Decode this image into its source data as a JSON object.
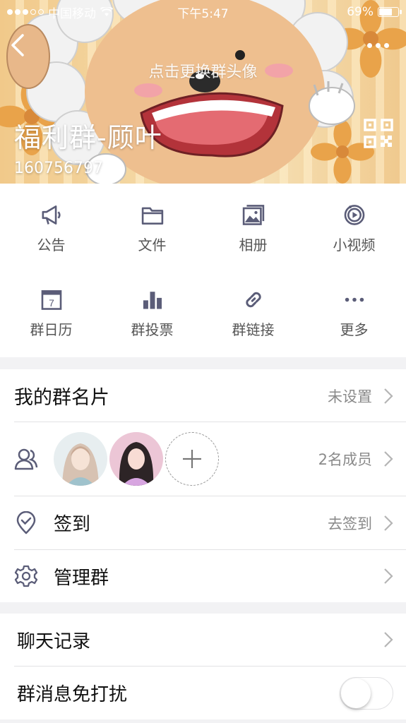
{
  "status_bar": {
    "carrier": "中国移动",
    "time": "下午5:47",
    "battery": "69%",
    "battery_level": 0.69
  },
  "header": {
    "change_avatar_hint": "点击更换群头像",
    "group_name": "福利群-顾叶",
    "group_id": "160756797",
    "back_icon": "chevron-left-icon",
    "more_icon": "ellipsis-icon",
    "qr_icon": "qr-code-icon"
  },
  "features": [
    {
      "label": "公告",
      "icon": "megaphone-icon"
    },
    {
      "label": "文件",
      "icon": "folder-icon"
    },
    {
      "label": "相册",
      "icon": "photo-album-icon"
    },
    {
      "label": "小视频",
      "icon": "video-play-icon"
    },
    {
      "label": "群日历",
      "icon": "calendar-icon",
      "calendar_day": "7"
    },
    {
      "label": "群投票",
      "icon": "bar-chart-icon"
    },
    {
      "label": "群链接",
      "icon": "link-icon"
    },
    {
      "label": "更多",
      "icon": "more-dots-icon"
    }
  ],
  "list": {
    "group_card": {
      "title": "我的群名片",
      "value": "未设置"
    },
    "members": {
      "value": "2名成员"
    },
    "checkin": {
      "title": "签到",
      "value": "去签到"
    },
    "manage": {
      "title": "管理群"
    },
    "chat_history": {
      "title": "聊天记录"
    },
    "mute": {
      "title": "群消息免打扰",
      "enabled": false
    }
  },
  "colors": {
    "icon": "#5b5d78",
    "text_secondary": "#8a8a8a",
    "background": "#f2f2f4"
  }
}
